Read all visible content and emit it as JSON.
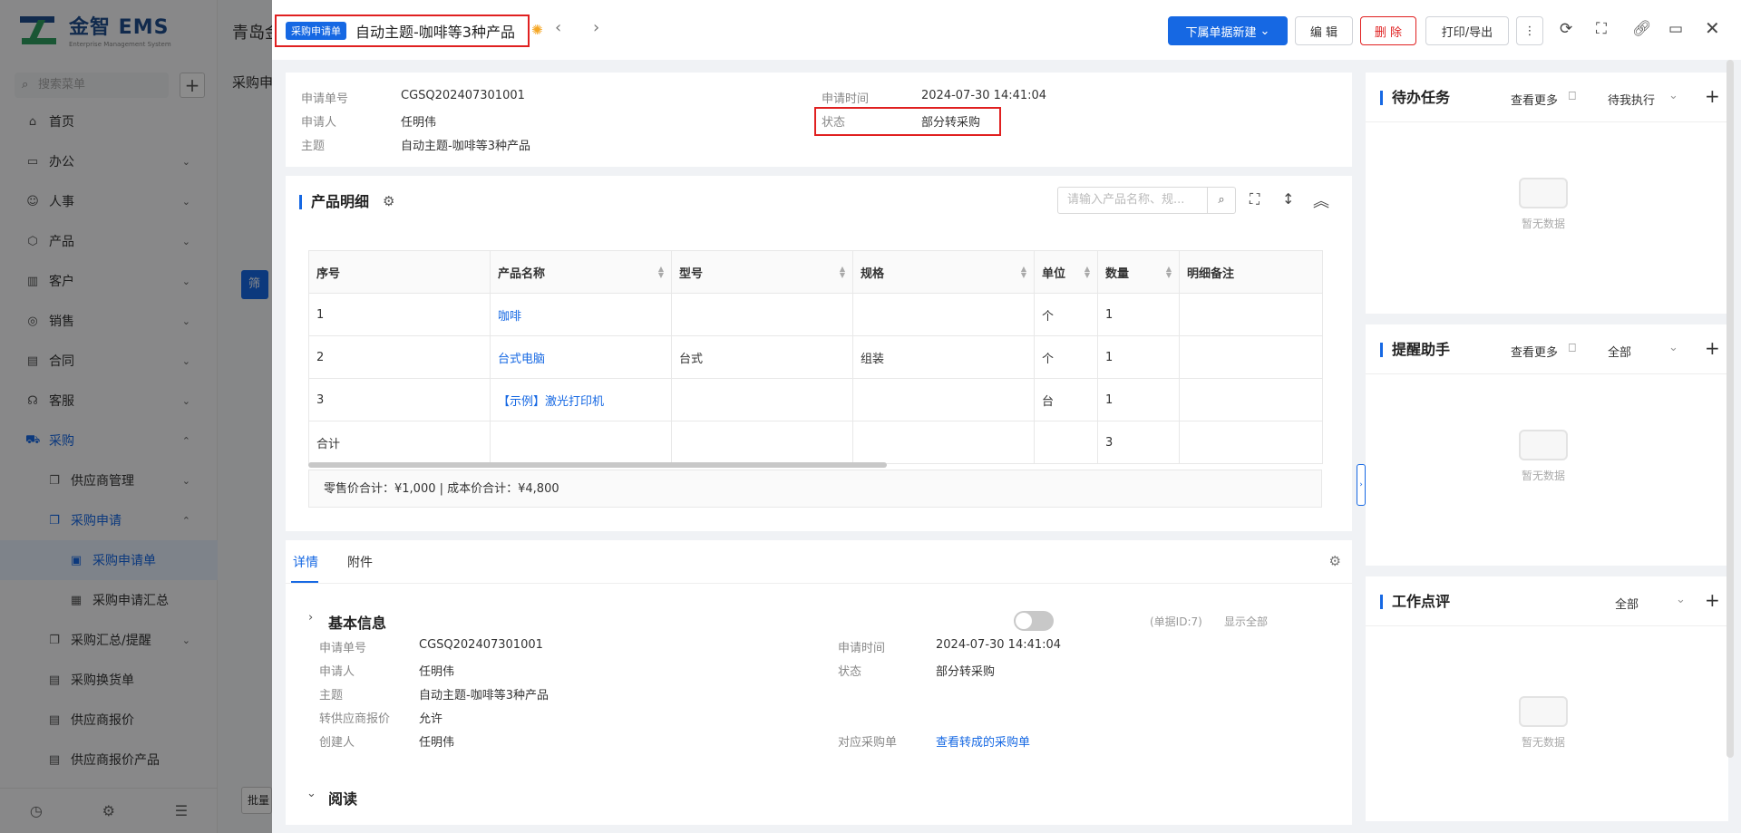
{
  "sidebar": {
    "logo_text": "金智 EMS",
    "logo_sub": "Enterprise Management System",
    "search_placeholder": "搜索菜单",
    "items": [
      {
        "label": "首页",
        "icon": "home-icon"
      },
      {
        "label": "办公",
        "icon": "office-icon"
      },
      {
        "label": "人事",
        "icon": "people-icon"
      },
      {
        "label": "产品",
        "icon": "product-icon"
      },
      {
        "label": "客户",
        "icon": "customer-icon"
      },
      {
        "label": "销售",
        "icon": "sales-icon"
      },
      {
        "label": "合同",
        "icon": "contract-icon"
      },
      {
        "label": "客服",
        "icon": "headset-icon"
      },
      {
        "label": "采购",
        "icon": "cart-icon"
      },
      {
        "label": "供应商管理",
        "icon": "folder-icon"
      },
      {
        "label": "采购申请",
        "icon": "folder-icon"
      },
      {
        "label": "采购申请单",
        "icon": "doc-icon"
      },
      {
        "label": "采购申请汇总",
        "icon": "list-icon"
      },
      {
        "label": "采购汇总/提醒",
        "icon": "folder-icon"
      },
      {
        "label": "采购换货单",
        "icon": "doc-icon"
      },
      {
        "label": "供应商报价",
        "icon": "doc-icon"
      },
      {
        "label": "供应商报价产品",
        "icon": "doc-icon"
      }
    ]
  },
  "background": {
    "title": "青岛金",
    "tab": "采购申",
    "filter_btn": "筛",
    "bottom_btn": "批量"
  },
  "drawer": {
    "header": {
      "tag": "采购申请单",
      "title": "自动主题-咖啡等3种产品",
      "btn_new": "下属单据新建",
      "btn_edit": "编 辑",
      "btn_delete": "删 除",
      "btn_print": "打印/导出"
    },
    "info": {
      "request_no_label": "申请单号",
      "request_no": "CGSQ202407301001",
      "requester_label": "申请人",
      "requester": "任明伟",
      "subject_label": "主题",
      "subject": "自动主题-咖啡等3种产品",
      "request_time_label": "申请时间",
      "request_time": "2024-07-30 14:41:04",
      "status_label": "状态",
      "status": "部分转采购"
    },
    "products": {
      "title": "产品明细",
      "search_placeholder": "请输入产品名称、规...",
      "columns": [
        "序号",
        "产品名称",
        "型号",
        "规格",
        "单位",
        "数量",
        "明细备注"
      ],
      "rows": [
        {
          "no": "1",
          "name": "咖啡",
          "model": "",
          "spec": "",
          "unit": "个",
          "qty": "1",
          "note": ""
        },
        {
          "no": "2",
          "name": "台式电脑",
          "model": "台式",
          "spec": "组装",
          "unit": "个",
          "qty": "1",
          "note": ""
        },
        {
          "no": "3",
          "name": "【示例】激光打印机",
          "model": "",
          "spec": "",
          "unit": "台",
          "qty": "1",
          "note": ""
        }
      ],
      "total_label": "合计",
      "total_qty": "3",
      "summary": "零售价合计：¥1,000 |   成本价合计：¥4,800"
    },
    "detail": {
      "tab_detail": "详情",
      "tab_attach": "附件",
      "basic_title": "基本信息",
      "doc_id": "(单据ID:7)",
      "show_all": "显示全部",
      "request_no_label": "申请单号",
      "request_no": "CGSQ202407301001",
      "requester_label": "申请人",
      "requester": "任明伟",
      "subject_label": "主题",
      "subject": "自动主题-咖啡等3种产品",
      "quote_label": "转供应商报价",
      "quote": "允许",
      "creator_label": "创建人",
      "creator": "任明伟",
      "request_time_label": "申请时间",
      "request_time": "2024-07-30 14:41:04",
      "status_label": "状态",
      "status": "部分转采购",
      "po_label": "对应采购单",
      "po_link": "查看转成的采购单",
      "read_title": "阅读"
    },
    "right": {
      "todo_title": "待办任务",
      "todo_more": "查看更多",
      "todo_filter": "待我执行",
      "remind_title": "提醒助手",
      "remind_more": "查看更多",
      "remind_filter": "全部",
      "review_title": "工作点评",
      "review_filter": "全部",
      "empty": "暂无数据"
    }
  }
}
